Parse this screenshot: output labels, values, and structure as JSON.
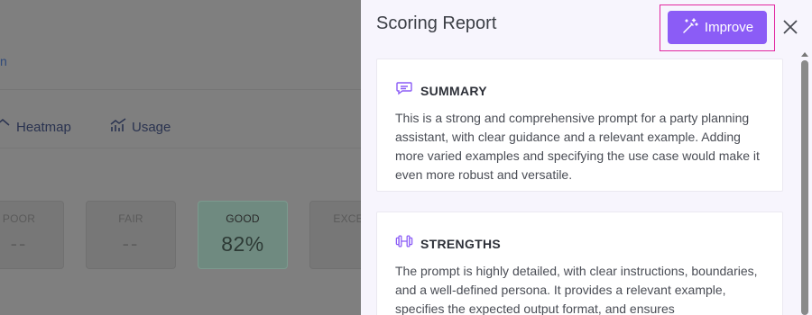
{
  "background": {
    "link_text": "n",
    "tabs": [
      {
        "label": "Heatmap",
        "icon": "heatmap-icon"
      },
      {
        "label": "Usage",
        "icon": "usage-chart-icon"
      }
    ],
    "score_cards": [
      {
        "label": "POOR",
        "value": "--"
      },
      {
        "label": "FAIR",
        "value": "--"
      },
      {
        "label": "GOOD",
        "value": "82%"
      },
      {
        "label": "EXCELL",
        "value": ""
      }
    ]
  },
  "drawer": {
    "title": "Scoring Report",
    "improve_label": "Improve",
    "improve_icon": "magic-wand-icon",
    "close_icon": "close-icon",
    "accent_color": "#8b5cf6",
    "highlight_color": "#e2269f",
    "sections": [
      {
        "title": "SUMMARY",
        "icon": "speech-bubble-icon",
        "body": "This is a strong and comprehensive prompt for a party planning assistant, with clear guidance and a relevant example. Adding more varied examples and specifying the use case would make it even more robust and versatile."
      },
      {
        "title": "STRENGTHS",
        "icon": "dumbbell-icon",
        "body": "The prompt is highly detailed, with clear instructions, boundaries, and a well-defined persona. It provides a relevant example, specifies the expected output format, and ensures"
      }
    ]
  }
}
